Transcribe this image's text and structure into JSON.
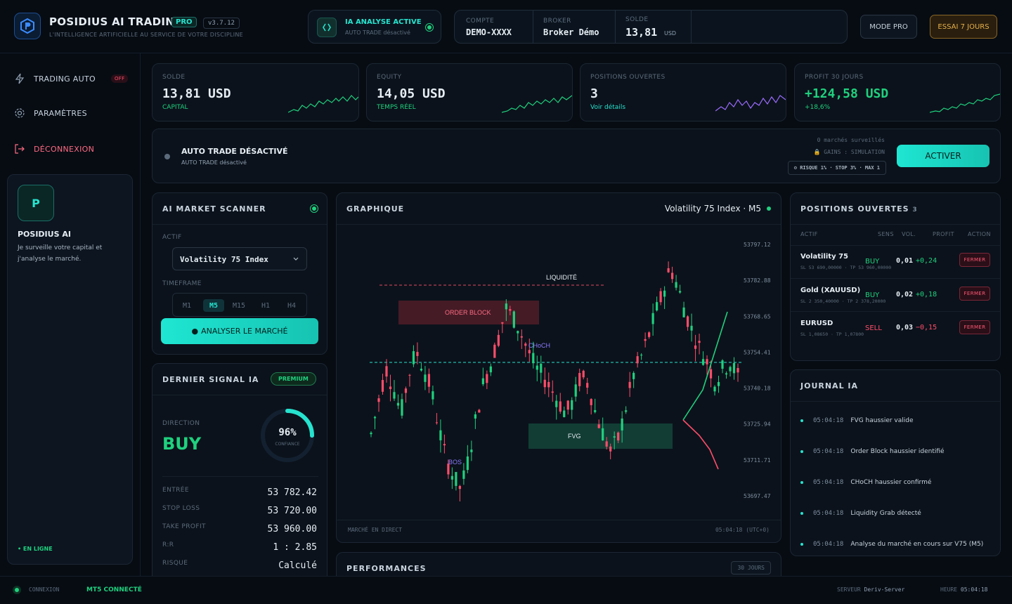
{
  "app": {
    "title": "POSIDIUS AI TRADING",
    "badge": "PRO",
    "version": "v3.7.12",
    "tagline": "L'INTELLIGENCE ARTIFICIELLE AU SERVICE DE VOTRE DISCIPLINE",
    "logo_letter": "P"
  },
  "ai_status": {
    "title": "IA ANALYSE ACTIVE",
    "subtitle": "AUTO TRADE désactivé"
  },
  "account": {
    "compte_label": "COMPTE",
    "compte_value": "DEMO-XXXX",
    "broker_label": "BROKER",
    "broker_value": "Broker Démo",
    "solde_label": "SOLDE",
    "solde_value": "13,81",
    "solde_currency": "USD"
  },
  "header_buttons": {
    "mode_pro": "MODE PRO",
    "trial": "ESSAI 7 JOURS"
  },
  "sidebar": {
    "items": [
      {
        "label": "TRADING AUTO",
        "badge": "OFF"
      },
      {
        "label": "PARAMÈTRES"
      },
      {
        "label": "DÉCONNEXION"
      }
    ],
    "ai_card": {
      "letter": "P",
      "title": "POSIDIUS AI",
      "text": "Je surveille votre capital et j'analyse le marché.",
      "status": "EN LIGNE"
    }
  },
  "stats": [
    {
      "label": "SOLDE",
      "value": "13,81 USD",
      "sub": "CAPITAL"
    },
    {
      "label": "EQUITY",
      "value": "14,05 USD",
      "sub": "TEMPS RÉEL"
    },
    {
      "label": "POSITIONS OUVERTES",
      "value": "3",
      "sub": "Voir détails"
    },
    {
      "label": "PROFIT 30 JOURS",
      "value": "+124,58 USD",
      "sub": "+18,6%"
    }
  ],
  "autotrade": {
    "title": "AUTO TRADE DÉSACTIVÉ",
    "subtitle": "AUTO TRADE désactivé",
    "markets": "0 marchés surveillés",
    "gains": "GAINS : SIMULATION",
    "risk": "RISQUE 1% · STOP 3% · MAX 1",
    "activate": "ACTIVER"
  },
  "scanner": {
    "title": "AI MARKET SCANNER",
    "asset_label": "ACTIF",
    "asset_value": "Volatility 75 Index",
    "timeframe_label": "TIMEFRAME",
    "timeframes": [
      "M1",
      "M5",
      "M15",
      "H1",
      "H4"
    ],
    "selected_timeframe": "M5",
    "analyze": "ANALYSER LE MARCHÉ"
  },
  "signal": {
    "title": "DERNIER SIGNAL IA",
    "badge": "PREMIUM",
    "direction_label": "DIRECTION",
    "direction": "BUY",
    "confidence": "96%",
    "confidence_value": 96,
    "confidence_label": "CONFIANCE",
    "rows": [
      {
        "label": "ENTRÉE",
        "value": "53 782.42"
      },
      {
        "label": "STOP LOSS",
        "value": "53 720.00"
      },
      {
        "label": "TAKE PROFIT",
        "value": "53 960.00"
      },
      {
        "label": "R:R",
        "value": "1 : 2.85"
      },
      {
        "label": "RISQUE",
        "value": "Calculé"
      }
    ]
  },
  "chart": {
    "title": "GRAPHIQUE",
    "symbol": "Volatility 75 Index · M5",
    "footer_left": "MARCHÉ EN DIRECT",
    "footer_right": "05:04:18 (UTC+0)",
    "annotations": {
      "liquidity": "LIQUIDITÉ",
      "order_block": "ORDER BLOCK",
      "choch": "CHoCH",
      "fvg": "FVG",
      "bos": "BOS"
    }
  },
  "chart_data": {
    "type": "candlestick",
    "title": "Volatility 75 Index · M5",
    "y_ticks": [
      53797.12,
      53782.88,
      53768.65,
      53754.41,
      53740.18,
      53725.94,
      53711.71,
      53697.47
    ],
    "ylim": [
      53697.47,
      53797.12
    ],
    "grid": false
  },
  "positions": {
    "title": "POSITIONS OUVERTES",
    "count": "3",
    "columns": [
      "ACTIF",
      "SENS",
      "VOL.",
      "PROFIT",
      "ACTION"
    ],
    "rows": [
      {
        "asset": "Volatility 75",
        "side": "BUY",
        "vol": "0,01",
        "profit": "+0,24",
        "sl": "SL 53 690,00000",
        "tp": "TP 53 960,00000",
        "action": "FERMER"
      },
      {
        "asset": "Gold (XAUUSD)",
        "side": "BUY",
        "vol": "0,02",
        "profit": "+0,18",
        "sl": "SL 2 350,40000",
        "tp": "TP 2 378,20000",
        "action": "FERMER"
      },
      {
        "asset": "EURUSD",
        "side": "SELL",
        "vol": "0,03",
        "profit": "−0,15",
        "sl": "SL 1,08650",
        "tp": "TP 1,07800",
        "action": "FERMER"
      }
    ]
  },
  "journal": {
    "title": "JOURNAL IA",
    "items": [
      {
        "time": "05:04:18",
        "text": "FVG haussier valide"
      },
      {
        "time": "05:04:18",
        "text": "Order Block haussier identifié"
      },
      {
        "time": "05:04:18",
        "text": "CHoCH haussier confirmé"
      },
      {
        "time": "05:04:18",
        "text": "Liquidity Grab détecté"
      },
      {
        "time": "05:04:18",
        "text": "Analyse du marché en cours sur V75 (M5)"
      }
    ]
  },
  "performance": {
    "title": "PERFORMANCES",
    "period": "30 JOURS"
  },
  "footer": {
    "connexion_label": "CONNEXION",
    "connexion_value": "MT5 CONNECTÉ",
    "server_label": "SERVEUR",
    "server_value": "Deriv-Server",
    "time_label": "HEURE",
    "time_value": "05:04:18"
  },
  "colors": {
    "accent": "#26e3cf",
    "buy": "#1fd17e",
    "sell": "#ff4d6a",
    "gold": "#e7b04a",
    "background": "#070c13"
  }
}
